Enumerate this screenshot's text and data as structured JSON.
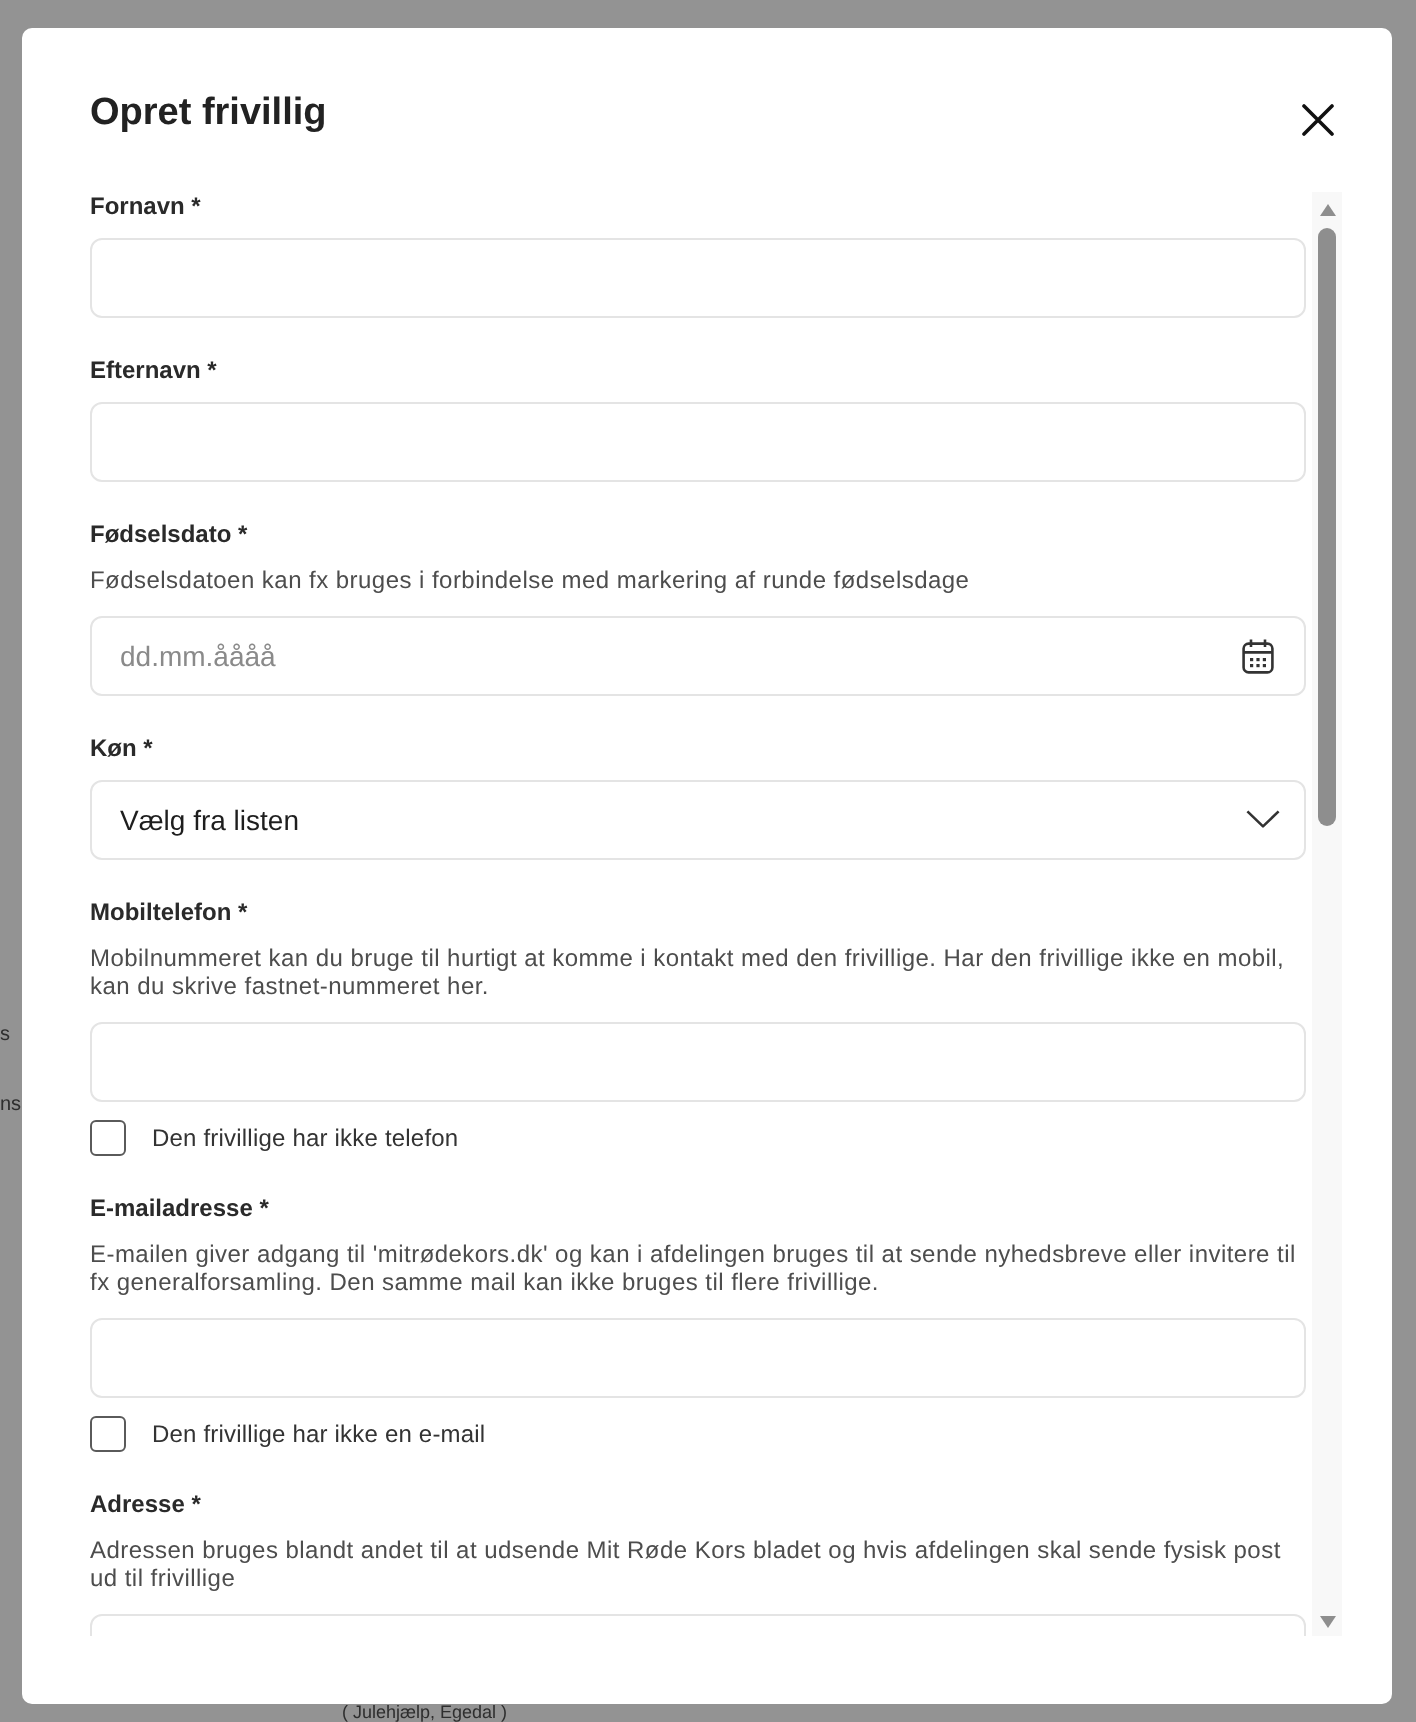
{
  "dialog": {
    "title": "Opret frivillig"
  },
  "fields": [
    {
      "kind": "text",
      "label": "Fornavn *"
    },
    {
      "kind": "text",
      "label": "Efternavn *"
    },
    {
      "kind": "date",
      "label": "Fødselsdato *",
      "help": "Fødselsdatoen kan fx bruges i forbindelse med markering af runde fødselsdage",
      "placeholder": "dd.mm.åååå"
    },
    {
      "kind": "select",
      "label": "Køn *",
      "value": "Vælg fra listen"
    },
    {
      "kind": "text",
      "label": "Mobiltelefon *",
      "help": "Mobilnummeret kan du bruge til hurtigt at komme i kontakt med den frivillige. Har den frivillige ikke en mobil, kan du skrive fastnet-nummeret her.",
      "checkbox": {
        "label": "Den frivillige har ikke telefon",
        "checked": false
      }
    },
    {
      "kind": "text",
      "label": "E-mailadresse *",
      "help": "E-mailen giver adgang til 'mitrødekors.dk' og kan i afdelingen bruges til at sende nyhedsbreve eller invitere til fx generalforsamling. Den samme mail kan ikke bruges til flere frivillige.",
      "checkbox": {
        "label": "Den frivillige har ikke en e-mail",
        "checked": false
      }
    },
    {
      "kind": "text",
      "label": "Adresse *",
      "help": "Adressen bruges blandt andet til at udsende Mit Røde Kors bladet og hvis afdelingen skal sende fysisk post ud til frivillige"
    }
  ],
  "background_page": {
    "side_fragments": [
      "s",
      "ns"
    ],
    "caption": "( Julehjælp, Egedal )"
  }
}
